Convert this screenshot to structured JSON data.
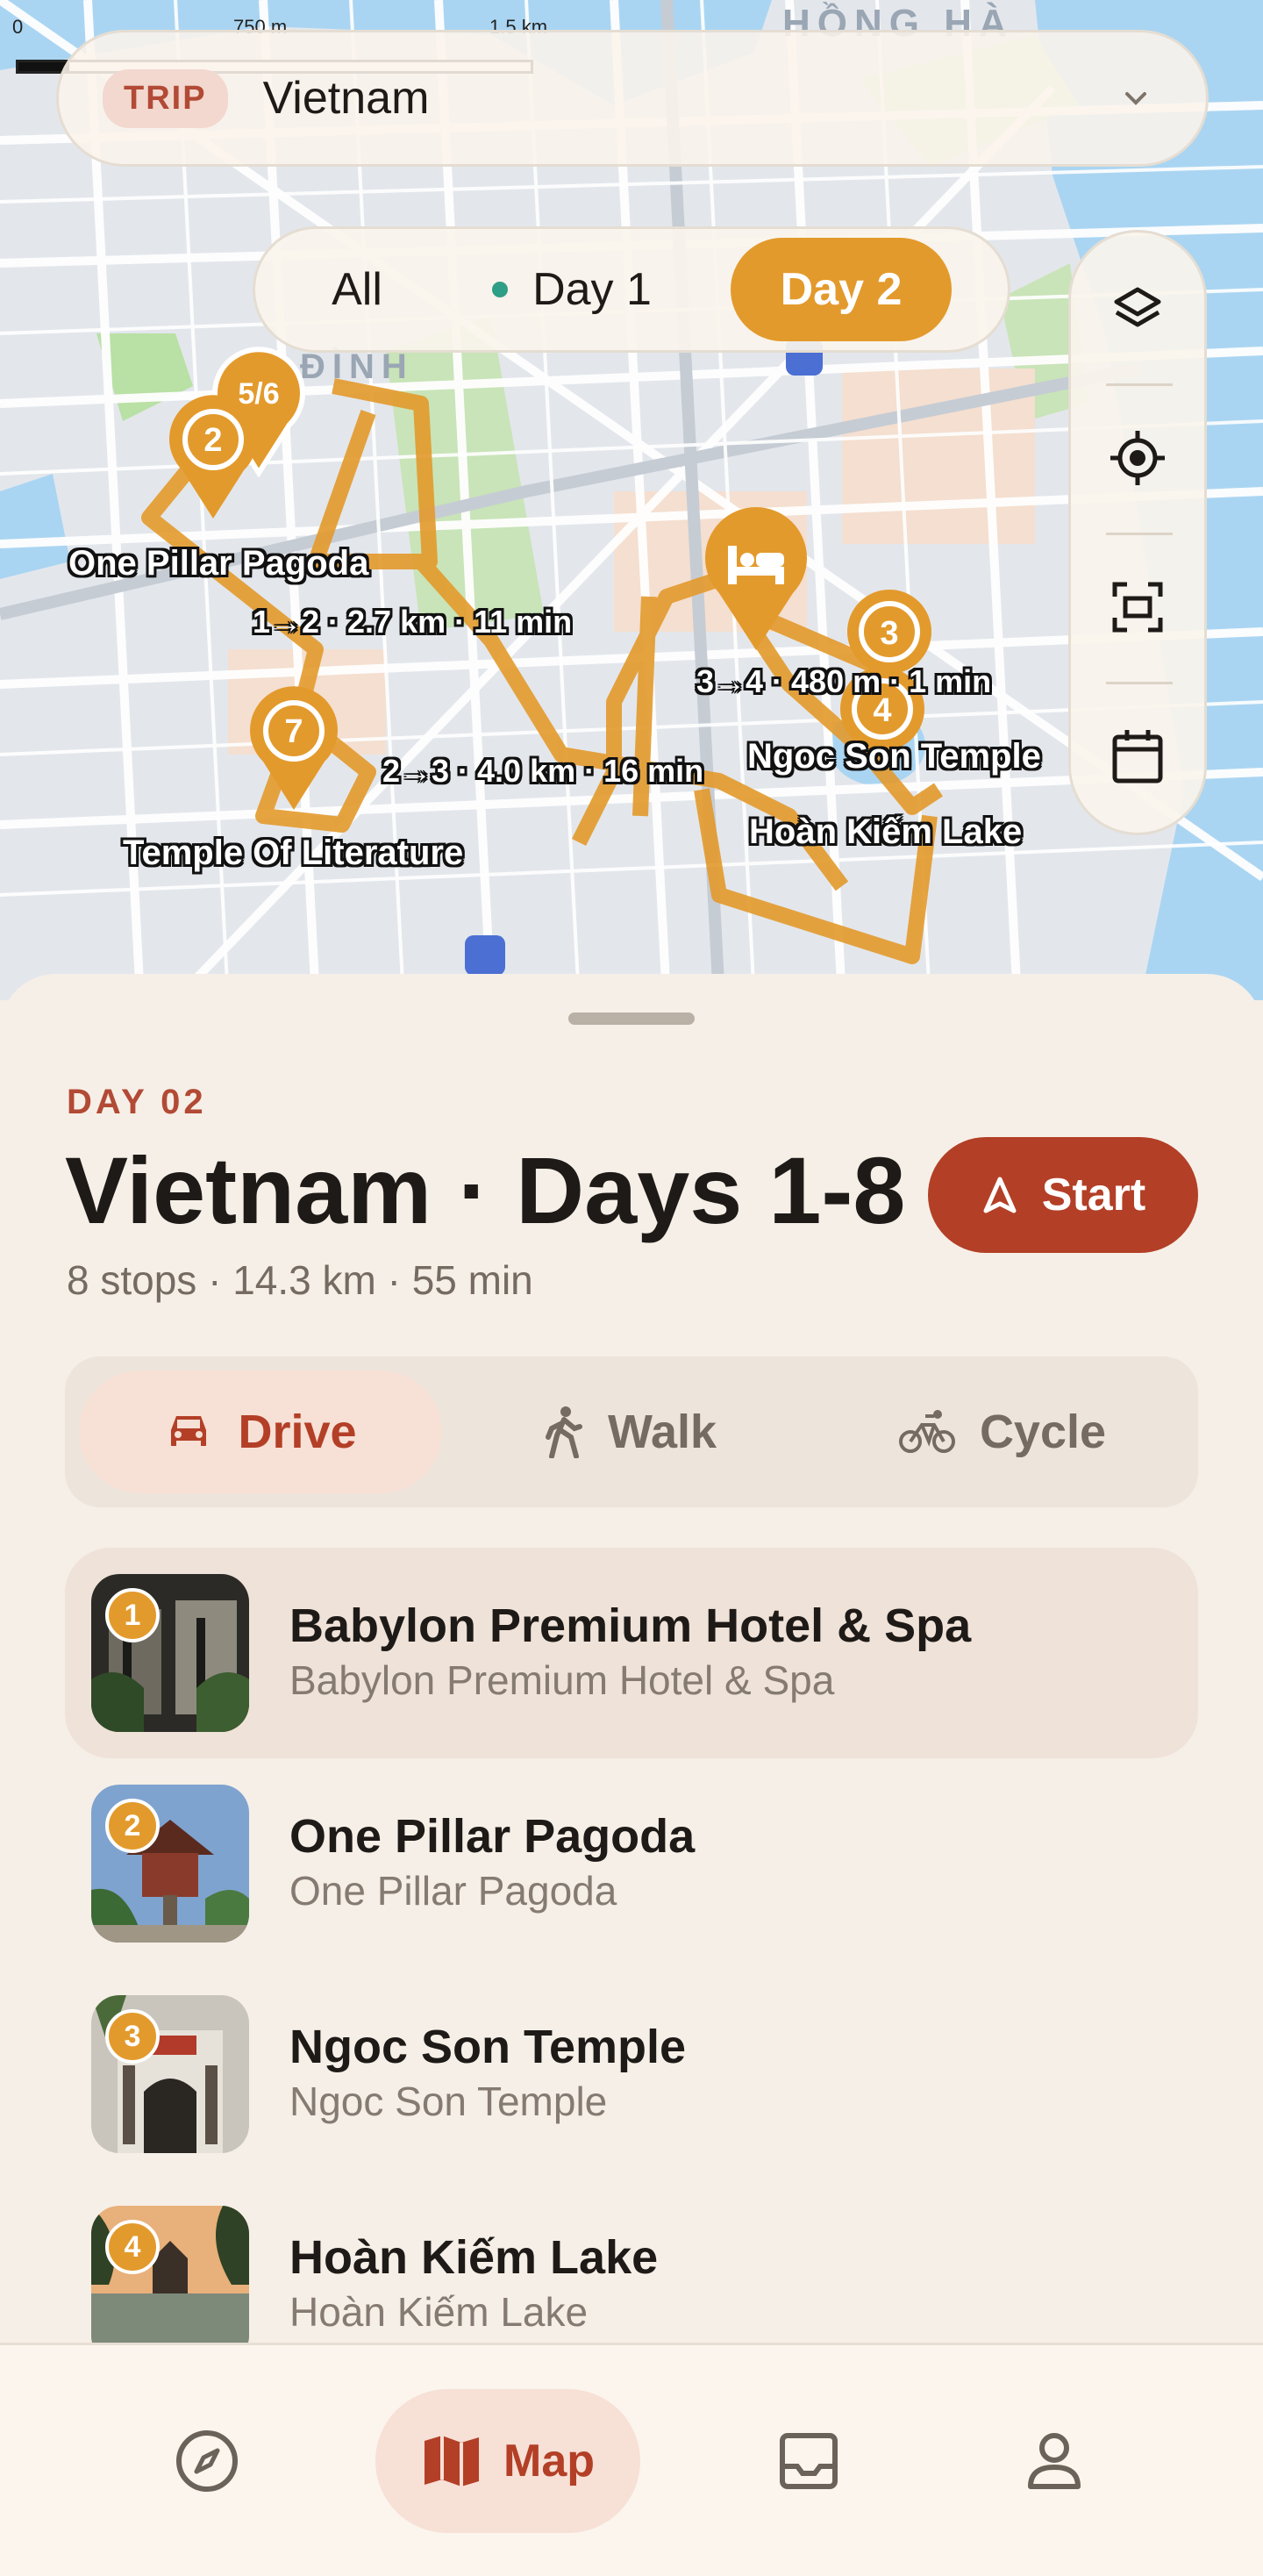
{
  "map": {
    "scale_ticks": [
      "0",
      "750 m",
      "1.5 km"
    ],
    "district_labels": [
      "HỒNG HÀ",
      "ĐÌNH"
    ],
    "trip": {
      "badge": "TRIP",
      "name": "Vietnam"
    },
    "filters": [
      "All",
      "Day 1",
      "Day 2"
    ],
    "active_filter": "Day 2",
    "pins": [
      "5/6",
      "2",
      "3",
      "4",
      "7"
    ],
    "place_labels": {
      "one_pillar": "One Pillar Pagoda",
      "temple_lit": "Temple Of Literature",
      "ngoc_son": "Ngoc Son Temple",
      "hoan_kiem": "Hoàn Kiếm Lake"
    },
    "segment_labels": {
      "s12": "1→2 · 2.7 km · 11 min",
      "s23": "2→3 · 4.0 km · 16 min",
      "s34": "3→4 · 480 m · 1 min"
    },
    "route_color": "#e39a2c"
  },
  "sheet": {
    "day_label": "DAY 02",
    "title": "Vietnam · Days 1-8",
    "start_label": "Start",
    "meta": "8 stops · 14.3 km · 55 min",
    "modes": [
      "Drive",
      "Walk",
      "Cycle"
    ],
    "active_mode": "Drive",
    "stops": [
      {
        "num": "1",
        "name": "Babylon Premium Hotel & Spa",
        "sub": "Babylon Premium Hotel & Spa"
      },
      {
        "num": "2",
        "name": "One Pillar Pagoda",
        "sub": "One Pillar Pagoda"
      },
      {
        "num": "3",
        "name": "Ngoc Son Temple",
        "sub": "Ngoc Son Temple"
      },
      {
        "num": "4",
        "name": "Hoàn Kiếm Lake",
        "sub": "Hoàn Kiếm Lake"
      }
    ]
  },
  "nav": {
    "map_label": "Map",
    "active": "Map"
  },
  "colors": {
    "accent": "#b33f27",
    "route": "#e39a2c",
    "background": "#f6efe7"
  }
}
